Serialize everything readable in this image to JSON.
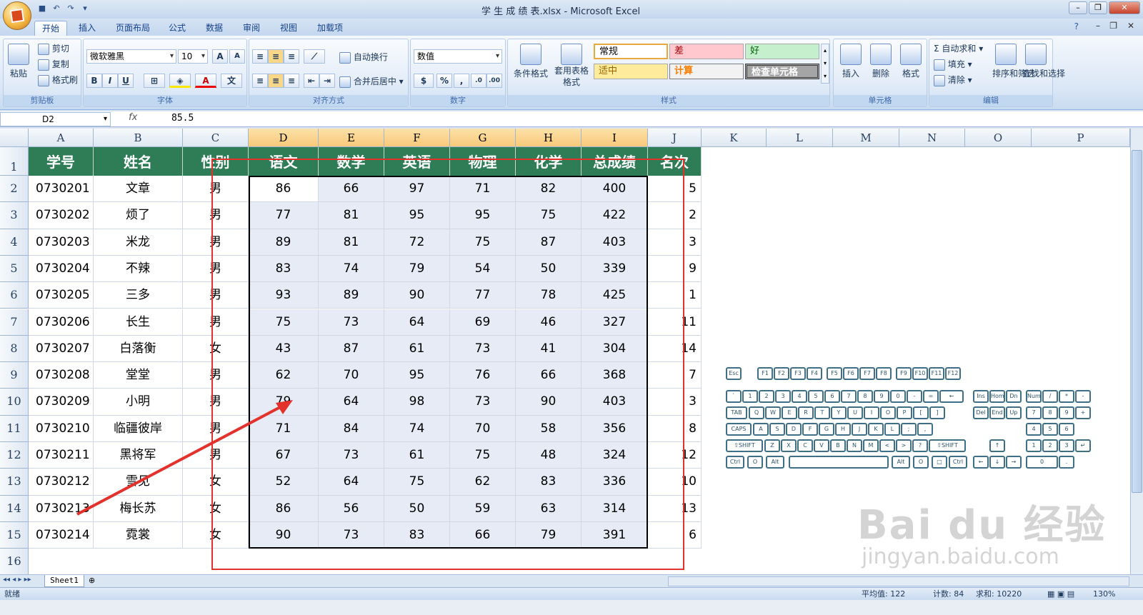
{
  "window": {
    "title": "学 生 成 绩 表.xlsx - Microsoft Excel"
  },
  "tabs": [
    "开始",
    "插入",
    "页面布局",
    "公式",
    "数据",
    "审阅",
    "视图",
    "加载项"
  ],
  "ribbon": {
    "clipboard": {
      "label": "剪贴板",
      "paste": "粘贴",
      "cut": "剪切",
      "copy": "复制",
      "format_painter": "格式刷"
    },
    "font": {
      "label": "字体",
      "name": "微软雅黑",
      "size": "10"
    },
    "alignment": {
      "label": "对齐方式",
      "wrap": "自动换行",
      "merge": "合并后居中"
    },
    "number": {
      "label": "数字",
      "format": "数值"
    },
    "styles": {
      "label": "样式",
      "conditional": "条件格式",
      "table": "套用表格格式",
      "cells": [
        "常规",
        "差",
        "好",
        "适中",
        "计算",
        "检查单元格"
      ]
    },
    "cells": {
      "label": "单元格",
      "insert": "插入",
      "delete": "删除",
      "format": "格式"
    },
    "editing": {
      "label": "编辑",
      "autosum": "自动求和",
      "fill": "填充",
      "clear": "清除",
      "sort": "排序和筛选",
      "find": "查找和选择"
    }
  },
  "formula_bar": {
    "name_box": "D2",
    "fx": "fx",
    "value": "85.5"
  },
  "columns": [
    "A",
    "B",
    "C",
    "D",
    "E",
    "F",
    "G",
    "H",
    "I",
    "J",
    "K",
    "L",
    "M",
    "N",
    "O",
    "P"
  ],
  "headers": [
    "学号",
    "姓名",
    "性别",
    "语文",
    "数学",
    "英语",
    "物理",
    "化学",
    "总成绩",
    "名次"
  ],
  "rows": [
    [
      "0730201",
      "文章",
      "男",
      "86",
      "66",
      "97",
      "71",
      "82",
      "400",
      "5"
    ],
    [
      "0730202",
      "烦了",
      "男",
      "77",
      "81",
      "95",
      "95",
      "75",
      "422",
      "2"
    ],
    [
      "0730203",
      "米龙",
      "男",
      "89",
      "81",
      "72",
      "75",
      "87",
      "403",
      "3"
    ],
    [
      "0730204",
      "不辣",
      "男",
      "83",
      "74",
      "79",
      "54",
      "50",
      "339",
      "9"
    ],
    [
      "0730205",
      "三多",
      "男",
      "93",
      "89",
      "90",
      "77",
      "78",
      "425",
      "1"
    ],
    [
      "0730206",
      "长生",
      "男",
      "75",
      "73",
      "64",
      "69",
      "46",
      "327",
      "11"
    ],
    [
      "0730207",
      "白落衡",
      "女",
      "43",
      "87",
      "61",
      "73",
      "41",
      "304",
      "14"
    ],
    [
      "0730208",
      "堂堂",
      "男",
      "62",
      "70",
      "95",
      "76",
      "66",
      "368",
      "7"
    ],
    [
      "0730209",
      "小明",
      "男",
      "79",
      "64",
      "98",
      "73",
      "90",
      "403",
      "3"
    ],
    [
      "0730210",
      "临疆彼岸",
      "男",
      "71",
      "84",
      "74",
      "70",
      "58",
      "356",
      "8"
    ],
    [
      "0730211",
      "黑将军",
      "男",
      "67",
      "73",
      "61",
      "75",
      "48",
      "324",
      "12"
    ],
    [
      "0730212",
      "雪见",
      "女",
      "52",
      "64",
      "75",
      "62",
      "83",
      "336",
      "10"
    ],
    [
      "0730213",
      "梅长苏",
      "女",
      "86",
      "56",
      "50",
      "59",
      "63",
      "314",
      "13"
    ],
    [
      "0730214",
      "霓裳",
      "女",
      "90",
      "73",
      "83",
      "66",
      "79",
      "391",
      "6"
    ]
  ],
  "row_numbers": [
    "1",
    "2",
    "3",
    "4",
    "5",
    "6",
    "7",
    "8",
    "9",
    "10",
    "11",
    "12",
    "13",
    "14",
    "15",
    "16"
  ],
  "sheet_tab": "Sheet1",
  "status": {
    "ready": "就绪",
    "average": "平均值: 122",
    "count": "计数: 84",
    "sum": "求和: 10220",
    "zoom": "130%"
  },
  "keyboard": {
    "row1": [
      "Esc",
      "F1",
      "F2",
      "F3",
      "F4",
      "F5",
      "F6",
      "F7",
      "F8",
      "F9",
      "F10",
      "F11",
      "F12"
    ],
    "row2": [
      "`",
      "1",
      "2",
      "3",
      "4",
      "5",
      "6",
      "7",
      "8",
      "9",
      "0",
      "-",
      "=",
      "←"
    ],
    "row3": [
      "TAB",
      "Q",
      "W",
      "E",
      "R",
      "T",
      "Y",
      "U",
      "I",
      "O",
      "P",
      "[",
      "]"
    ],
    "row4": [
      "CAPS",
      "A",
      "S",
      "D",
      "F",
      "G",
      "H",
      "J",
      "K",
      "L",
      ";",
      ","
    ],
    "row5": [
      "⇧SHIFT",
      "Z",
      "X",
      "C",
      "V",
      "B",
      "N",
      "M",
      "<",
      ">",
      "?",
      "⇧SHIFT"
    ],
    "row6": [
      "Ctrl",
      "O",
      "Alt",
      "",
      "Alt",
      "O",
      "□",
      "Ctrl"
    ],
    "nav1": [
      "Ins",
      "Hom",
      "Dn"
    ],
    "nav2": [
      "Del",
      "End",
      "Up"
    ],
    "num1": [
      "Num",
      "/",
      "*",
      "-"
    ],
    "num2": [
      "7",
      "8",
      "9",
      "+"
    ],
    "num3": [
      "4",
      "5",
      "6"
    ],
    "num4": [
      "1",
      "2",
      "3",
      "↵"
    ],
    "num5": [
      "0",
      "."
    ],
    "arrows": [
      "↑",
      "←",
      "↓",
      "→"
    ]
  },
  "watermark": {
    "brand": "Bai du 经验",
    "url": "jingyan.baidu.com"
  },
  "colors": {
    "header_green": "#2e7d57",
    "annotation_red": "#e3312c",
    "selection_fill": "#e6ebf5"
  }
}
